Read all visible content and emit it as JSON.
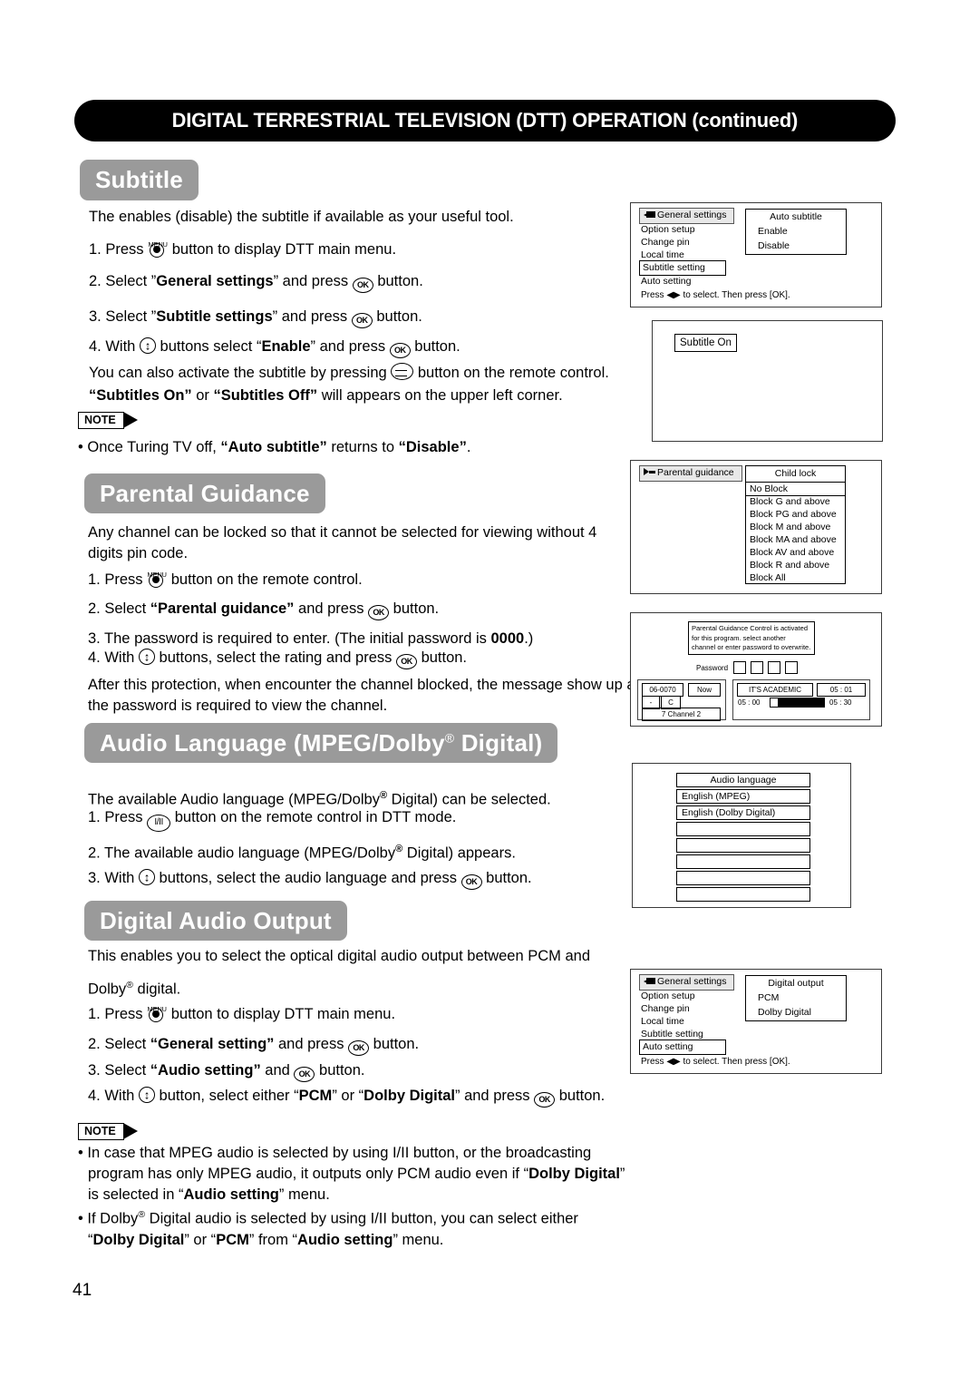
{
  "page": {
    "banner_title": "DIGITAL TERRESTRIAL TELEVISION (DTT) OPERATION (continued)",
    "page_number": "41"
  },
  "sections": {
    "subtitle": {
      "heading": "Subtitle",
      "intro": "The enables (disable) the subtitle if available as your useful tool.",
      "step1_pre": "1. Press",
      "step1_post": "button to display DTT main menu.",
      "step2_pre": "2. Select ”",
      "step2_bold": "General settings",
      "step2_mid": "” and press",
      "step2_post": "button.",
      "step3_pre": "3. Select ”",
      "step3_bold": "Subtitle settings",
      "step3_mid": "” and press",
      "step3_post": "button.",
      "step4_pre": "4. With",
      "step4_mid": "buttons select “",
      "step4_bold": "Enable",
      "step4_mid2": "” and press",
      "step4_post": "button.",
      "extra_pre": "You can also activate the subtitle by pressing",
      "extra_post": "button on the remote control.",
      "extra_line2_a": "“Subtitles On”",
      "extra_line2_b": " or ",
      "extra_line2_c": "“Subtitles Off”",
      "extra_line2_d": " will appears on the upper left corner.",
      "note_label": "NOTE",
      "note_pre": "• Once Turing TV off, ",
      "note_bold1": "“Auto subtitle”",
      "note_mid": " returns to ",
      "note_bold2": "“Disable”",
      "note_end": "."
    },
    "parental": {
      "heading": "Parental Guidance",
      "intro": "Any channel can be locked so that it cannot be selected for viewing without 4 digits pin code.",
      "step1_pre": "1. Press",
      "step1_post": "button on the remote control.",
      "step2_pre": "2. Select ",
      "step2_bold": "“Parental guidance”",
      "step2_mid": " and press",
      "step2_post": "button.",
      "step3_pre": "3. The password is required to enter. (The initial password is ",
      "step3_bold": "0000",
      "step3_post": ".)",
      "step4_pre": "4. With",
      "step4_mid": "buttons, select the rating and press",
      "step4_post": "button.",
      "outro": "After this protection, when encounter the channel blocked, the message show up and the password is required to view the channel."
    },
    "audio_language": {
      "heading_a": "Audio Language (MPEG/Dolby",
      "heading_reg": "®",
      "heading_b": " Digital)",
      "intro_a": "The available Audio language (MPEG/Dolby",
      "intro_reg": "®",
      "intro_b": " Digital) can be selected.",
      "step1_pre": "1. Press",
      "step1_post": "button on the remote control in DTT mode.",
      "step2_a": "2. The available audio language (MPEG/Dolby",
      "step2_reg": "®",
      "step2_b": " Digital) appears.",
      "step3_pre": "3. With",
      "step3_mid": "buttons, select the audio language and press",
      "step3_post": "button."
    },
    "digital_audio_output": {
      "heading": "Digital Audio Output",
      "intro_line1": "This enables you to select the optical digital audio output between PCM and",
      "intro_line2_a": "Dolby",
      "intro_line2_reg": "®",
      "intro_line2_b": " digital.",
      "step1_pre": "1. Press",
      "step1_post": "button to display DTT main menu.",
      "step2_pre": "2. Select ",
      "step2_bold": "“General setting”",
      "step2_mid": " and press",
      "step2_post": "button.",
      "step3_pre": "3. Select ",
      "step3_bold": "“Audio setting”",
      "step3_mid": " and",
      "step3_post": "button.",
      "step4_pre": "4. With",
      "step4_mid": "button, select either “",
      "step4_bold1": "PCM",
      "step4_mid2": "” or “",
      "step4_bold2": "Dolby Digital",
      "step4_mid3": "” and press",
      "step4_post": "button.",
      "note_label": "NOTE",
      "note1_a": "• In case that MPEG audio is selected by using I/II button, or the broadcasting",
      "note1_b": "program has only MPEG audio, it outputs only PCM audio even if “",
      "note1_bold1": "Dolby Digital",
      "note1_c": "”",
      "note1_d": "is selected in “",
      "note1_bold2": "Audio setting",
      "note1_e": "” menu.",
      "note2_a": "• If Dolby",
      "note2_reg": "®",
      "note2_b": " Digital audio is selected by using I/II button, you can select either",
      "note2_c": "“",
      "note2_bold1": "Dolby Digital",
      "note2_d": "” or “",
      "note2_bold2": "PCM",
      "note2_e": "” from “",
      "note2_bold3": "Audio setting",
      "note2_f": "” menu."
    }
  },
  "osd": {
    "general_settings_subtitle": {
      "menu_title": "General settings",
      "items": [
        "Option setup",
        "Change pin",
        "Local time",
        "Subtitle setting",
        "Auto setting"
      ],
      "selected_index": 3,
      "submenu_title": "Auto subtitle",
      "submenu_options": [
        "Enable",
        "Disable"
      ],
      "footer": "Press ◀▶ to select. Then press [OK]."
    },
    "subtitle_on_screen": {
      "badge": "Subtitle On"
    },
    "parental_guidance": {
      "menu_title": "Parental guidance",
      "submenu_title": "Child lock",
      "options": [
        "No Block",
        "Block G and above",
        "Block PG and above",
        "Block M and above",
        "Block MA and above",
        "Block AV and above",
        "Block R and above",
        "Block All"
      ],
      "selected_index": 0
    },
    "password_dialog": {
      "message": "Parental Guidance Control is activated\nfor this program. select another\nchannel or enter password to overwrite.",
      "password_label": "Password",
      "password_cells": 4,
      "channel_id": "06-0070",
      "now_label": "Now",
      "dash_label": "-",
      "c_label": "C",
      "channel_name": "7 Channel 2",
      "program_title": "IT'S ACADEMIC",
      "program_clock": "05 : 01",
      "start_time": "05 : 00",
      "end_time": "05 : 30",
      "progress_percent": 14
    },
    "audio_language_panel": {
      "title": "Audio language",
      "rows": [
        "English (MPEG)",
        "English (Dolby Digital)",
        "",
        "",
        "",
        "",
        ""
      ]
    },
    "general_settings_audio": {
      "menu_title": "General settings",
      "items": [
        "Option setup",
        "Change pin",
        "Local time",
        "Subtitle setting",
        "Auto setting"
      ],
      "selected_index": 4,
      "submenu_title": "Digital output",
      "submenu_options": [
        "PCM",
        "Dolby Digital"
      ],
      "footer": "Press ◀▶ to select. Then press [OK]."
    }
  }
}
